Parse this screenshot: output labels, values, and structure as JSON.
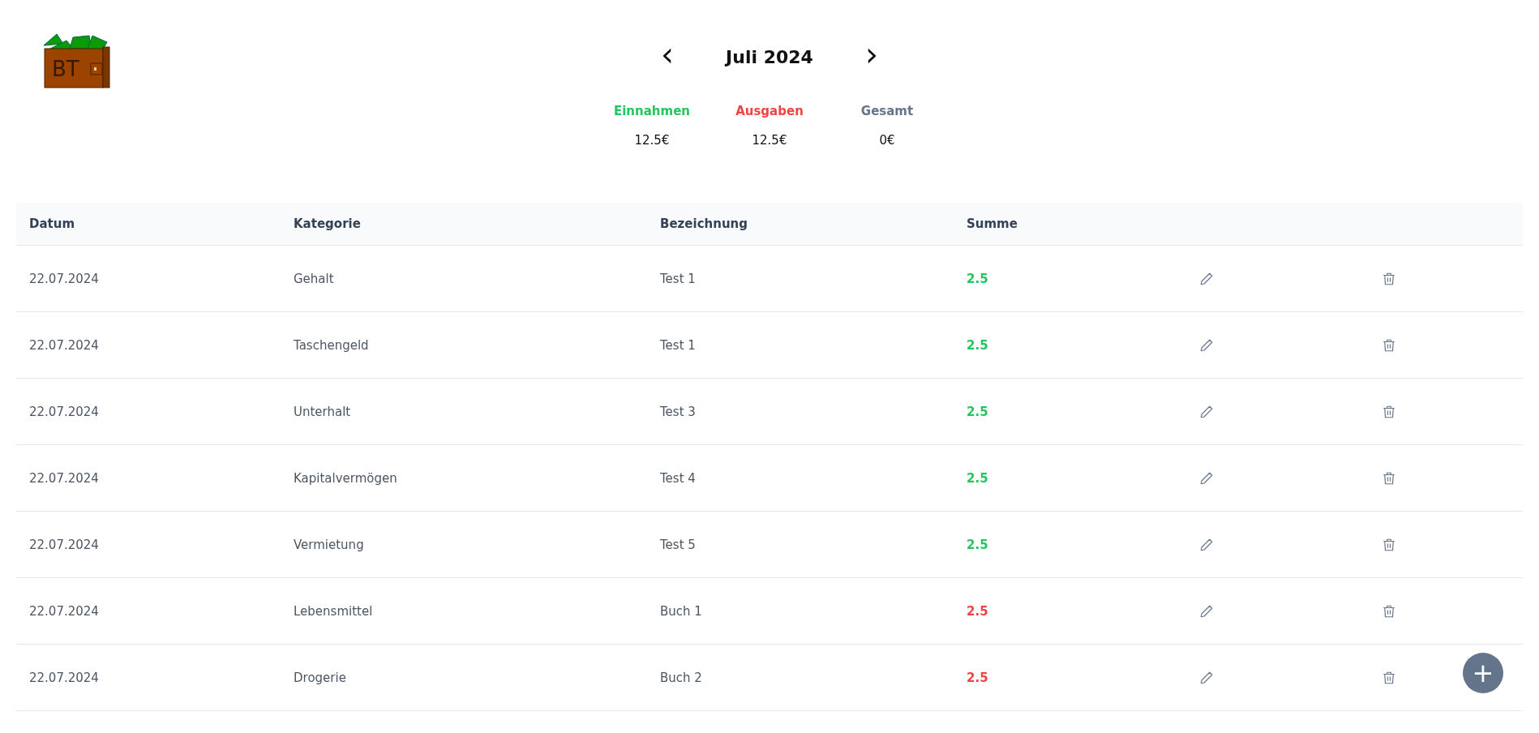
{
  "logo": {
    "text": "BT"
  },
  "month_nav": {
    "prev": "‹",
    "title": "Juli 2024",
    "next": "›"
  },
  "summary": [
    {
      "label": "Einnahmen",
      "value": "12.5€",
      "kind": "income"
    },
    {
      "label": "Ausgaben",
      "value": "12.5€",
      "kind": "expense"
    },
    {
      "label": "Gesamt",
      "value": "0€",
      "kind": "total"
    }
  ],
  "table": {
    "columns": [
      "Datum",
      "Kategorie",
      "Bezeichnung",
      "Summe"
    ],
    "rows": [
      {
        "date": "22.07.2024",
        "category": "Gehalt",
        "name": "Test 1",
        "amount": "2.5",
        "kind": "income"
      },
      {
        "date": "22.07.2024",
        "category": "Taschengeld",
        "name": "Test 1",
        "amount": "2.5",
        "kind": "income"
      },
      {
        "date": "22.07.2024",
        "category": "Unterhalt",
        "name": "Test 3",
        "amount": "2.5",
        "kind": "income"
      },
      {
        "date": "22.07.2024",
        "category": "Kapitalvermögen",
        "name": "Test 4",
        "amount": "2.5",
        "kind": "income"
      },
      {
        "date": "22.07.2024",
        "category": "Vermietung",
        "name": "Test 5",
        "amount": "2.5",
        "kind": "income"
      },
      {
        "date": "22.07.2024",
        "category": "Lebensmittel",
        "name": "Buch 1",
        "amount": "2.5",
        "kind": "expense"
      },
      {
        "date": "22.07.2024",
        "category": "Drogerie",
        "name": "Buch 2",
        "amount": "2.5",
        "kind": "expense"
      }
    ]
  },
  "add_button": {
    "label": "+"
  }
}
